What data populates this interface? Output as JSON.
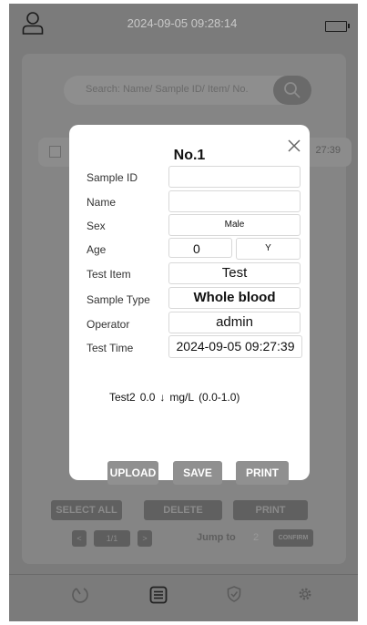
{
  "status_bar": {
    "datetime": "2024-09-05  09:28:14"
  },
  "search": {
    "placeholder": "Search: Name/ Sample ID/ Item/ No."
  },
  "background_list": {
    "row_time": "27:39"
  },
  "background_actions": {
    "select_all": "SELECT ALL",
    "delete": "DELETE",
    "print": "PRINT"
  },
  "pagination": {
    "prev": "<",
    "page": "1/1",
    "next": ">",
    "jump_label": "Jump to",
    "jump_value": "2",
    "confirm": "CONFIRM"
  },
  "modal": {
    "title": "No.1",
    "close_icon": "close-icon",
    "fields": {
      "sample_id": {
        "label": "Sample ID",
        "value": ""
      },
      "name": {
        "label": "Name",
        "value": ""
      },
      "sex": {
        "label": "Sex",
        "value": "Male"
      },
      "age": {
        "label": "Age",
        "value": "0",
        "unit": "Y"
      },
      "test_item": {
        "label": "Test Item",
        "value": "Test"
      },
      "sample_type": {
        "label": "Sample Type",
        "value": "Whole blood"
      },
      "operator": {
        "label": "Operator",
        "value": "admin"
      },
      "test_time": {
        "label": "Test Time",
        "value": "2024-09-05 09:27:39"
      }
    },
    "result": {
      "item": "Test2",
      "value": "0.0",
      "flag": "↓",
      "unit": "mg/L",
      "range": "(0.0-1.0)"
    },
    "buttons": {
      "upload": "UPLOAD",
      "save": "SAVE",
      "print": "PRINT"
    }
  },
  "bottom_nav": [
    "history-icon",
    "list-icon",
    "shield-icon",
    "settings-icon"
  ],
  "colors": {
    "overlay": "#7b7b7b",
    "modal_bg": "#ffffff",
    "button_gray": "#909090"
  }
}
